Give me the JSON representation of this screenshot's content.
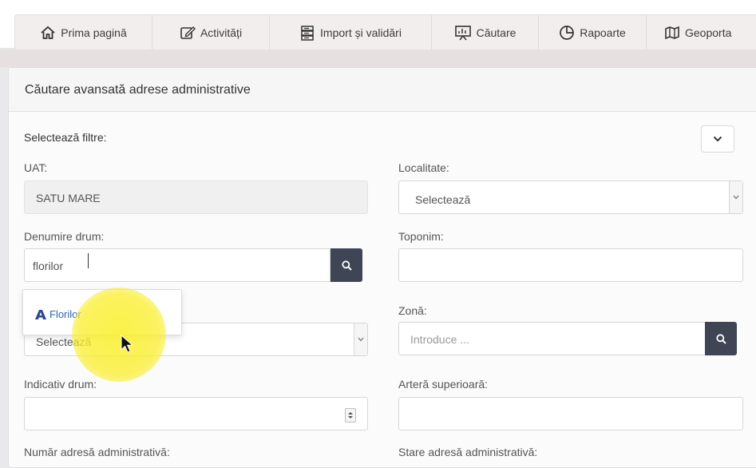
{
  "nav": {
    "items": [
      {
        "label": "Prima pagină",
        "icon": "home-icon"
      },
      {
        "label": "Activități",
        "icon": "edit-icon"
      },
      {
        "label": "Import și validări",
        "icon": "database-icon"
      },
      {
        "label": "Căutare",
        "icon": "presentation-icon"
      },
      {
        "label": "Rapoarte",
        "icon": "pie-chart-icon"
      },
      {
        "label": "Geoporta",
        "icon": "map-icon"
      }
    ]
  },
  "panel": {
    "title": "Căutare avansată adrese administrative",
    "filters_label": "Selectează filtre:"
  },
  "form": {
    "uat": {
      "label": "UAT:",
      "value": "SATU MARE"
    },
    "localitate": {
      "label": "Localitate:",
      "value": "Selectează"
    },
    "denumire_drum": {
      "label": "Denumire drum:",
      "value": "florilor"
    },
    "toponim": {
      "label": "Toponim:",
      "value": ""
    },
    "tip_drum": {
      "value": "Selectează"
    },
    "zona": {
      "label": "Zonă:",
      "placeholder": "Introduce ..."
    },
    "indicativ_drum": {
      "label": "Indicativ drum:",
      "value": ""
    },
    "artera_superioara": {
      "label": "Arteră superioară:",
      "value": ""
    },
    "numar_adresa": {
      "label": "Număr adresă administrativă:"
    },
    "stare_adresa": {
      "label": "Stare adresă administrativă:"
    }
  },
  "autocomplete": {
    "items": [
      {
        "label": "Florilor",
        "icon": "road-icon"
      }
    ]
  },
  "colors": {
    "accent": "#3f4555",
    "nav_bg": "#f3eeee",
    "link": "#2e66b5",
    "highlight": "#f7ec2c"
  }
}
